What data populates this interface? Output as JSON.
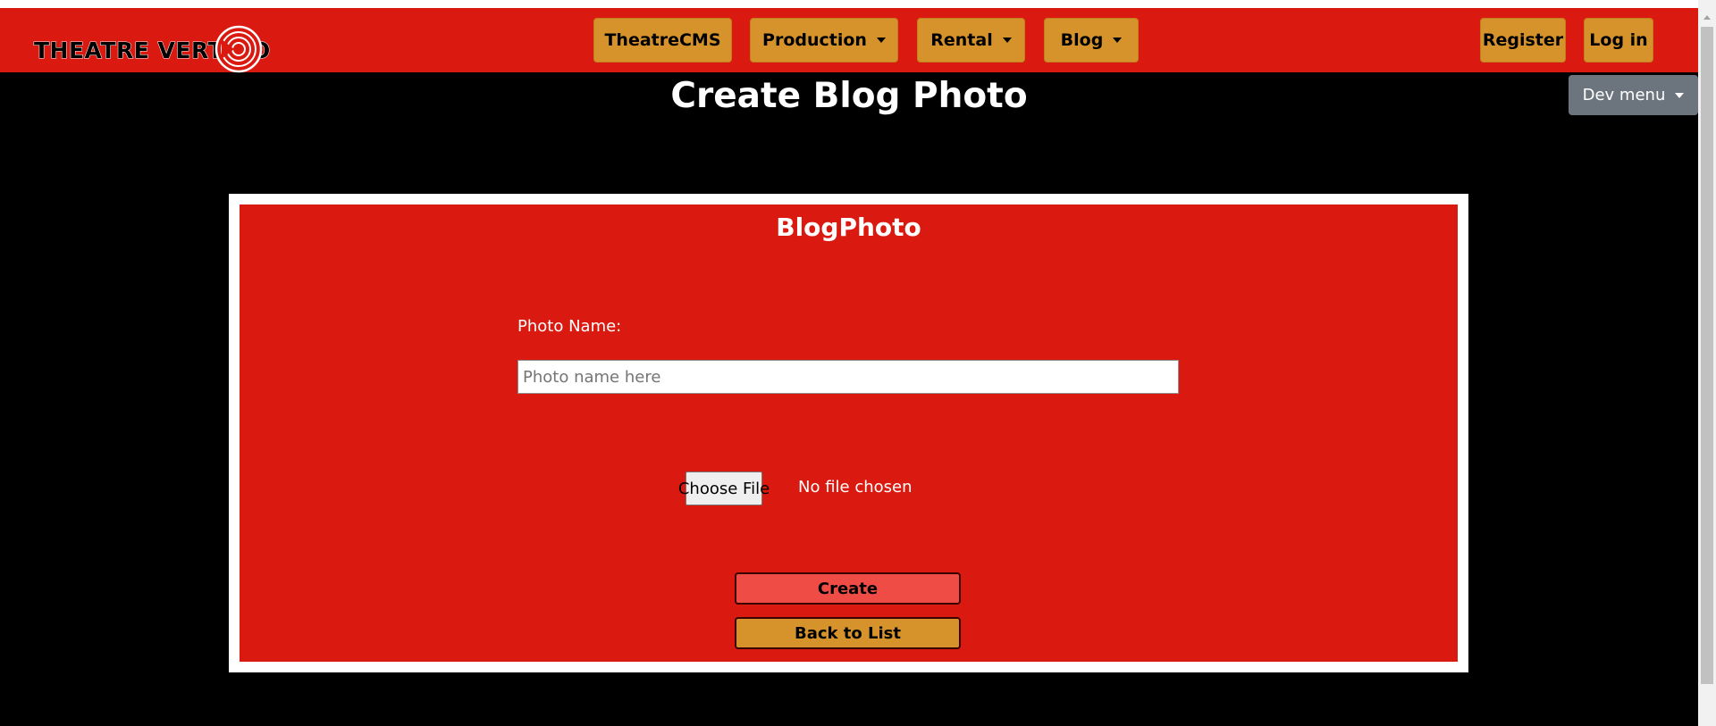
{
  "brand": {
    "logo_text": "THEATRE VERTIGO",
    "colors": {
      "navbar": "#da1a10",
      "button": "#d6922b",
      "create_button": "#ef4c45",
      "dev_menu": "#6c757d",
      "background": "#000000"
    }
  },
  "nav": {
    "items": [
      {
        "label": "TheatreCMS",
        "has_dropdown": false
      },
      {
        "label": "Production",
        "has_dropdown": true
      },
      {
        "label": "Rental",
        "has_dropdown": true
      },
      {
        "label": "Blog",
        "has_dropdown": true
      }
    ],
    "auth": {
      "register_label": "Register",
      "login_label": "Log in"
    }
  },
  "dev_menu": {
    "label": "Dev menu"
  },
  "page": {
    "title": "Create Blog Photo"
  },
  "form": {
    "title": "BlogPhoto",
    "photo_name": {
      "label": "Photo Name:",
      "placeholder": "Photo name here",
      "value": ""
    },
    "file": {
      "button_label": "Choose File",
      "status": "No file chosen"
    },
    "create_label": "Create",
    "back_label": "Back to List"
  }
}
